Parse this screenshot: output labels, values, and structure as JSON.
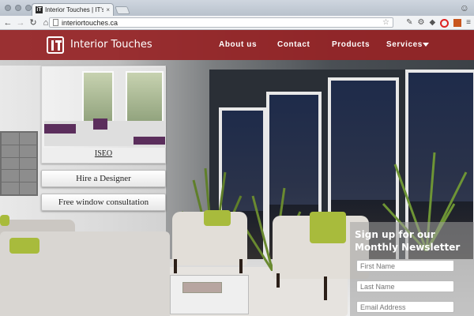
{
  "browser": {
    "tab_title": "Interior Touches | IT's always",
    "tab_favicon_text": "iT",
    "url": "interiortouches.ca"
  },
  "site": {
    "brand": "Interior Touches",
    "nav": [
      {
        "label": "About us"
      },
      {
        "label": "Contact"
      },
      {
        "label": "Products"
      },
      {
        "label": "Services"
      }
    ],
    "feature_card": {
      "caption": "ISEO"
    },
    "buttons": {
      "hire": "Hire a Designer",
      "consult": "Free window consultation"
    },
    "newsletter": {
      "heading": "Sign up for our Monthly Newsletter",
      "first_name": "First Name",
      "last_name": "Last Name",
      "email": "Email Address"
    },
    "colors": {
      "header": "#962326",
      "accent_pillow": "#a8bb3c"
    }
  }
}
